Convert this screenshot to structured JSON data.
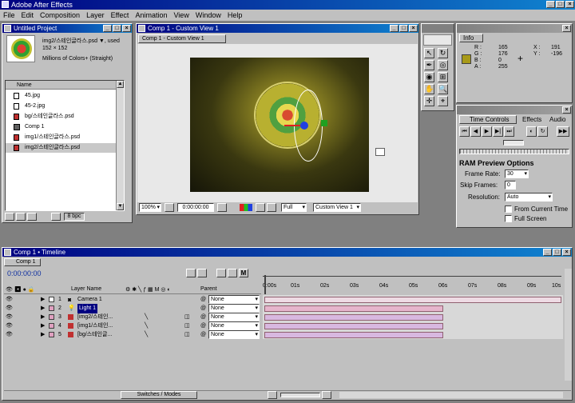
{
  "app": {
    "title": "Adobe After Effects",
    "window_buttons": [
      "_",
      "□",
      "×"
    ]
  },
  "menu": [
    "File",
    "Edit",
    "Composition",
    "Layer",
    "Effect",
    "Animation",
    "View",
    "Window",
    "Help"
  ],
  "project": {
    "title": "Untitled Project",
    "preview_name": "img2/스테인글라스.psd ▼, used",
    "preview_size": "152 × 152",
    "preview_colors": "Millions of Colors+ (Straight)",
    "col_name": "Name",
    "items": [
      {
        "icon": "file",
        "label": "45.jpg"
      },
      {
        "icon": "file",
        "label": "45-2.jpg"
      },
      {
        "icon": "psd",
        "label": "bg/스테인글라스.psd"
      },
      {
        "icon": "comp",
        "label": "Comp 1"
      },
      {
        "icon": "psd",
        "label": "img1/스테인글라스.psd"
      },
      {
        "icon": "psd",
        "label": "img2/스테인글라스.psd"
      }
    ],
    "bpc": "8 bpc"
  },
  "comp": {
    "title": "Comp 1 - Custom View 1",
    "tab": "Comp 1 - Custom View 1",
    "zoom": "100%",
    "timecode": "0:00:00:00",
    "resolution": "Full",
    "view": "Custom View 1"
  },
  "tools": [
    "arrow",
    "rotate",
    "pen",
    "orbit",
    "camera",
    "track-xy",
    "hand",
    "zoom",
    "axis",
    "pan"
  ],
  "info": {
    "title": "Info",
    "r_label": "R :",
    "r_val": "165",
    "g_label": "G :",
    "g_val": "176",
    "b_label": "B :",
    "b_val": "0",
    "a_label": "A :",
    "a_val": "255",
    "x_label": "X :",
    "x_val": "191",
    "y_label": "Y :",
    "y_val": "-196",
    "swatch": "#a89a18"
  },
  "timecontrols": {
    "tab1": "Time Controls",
    "tab2": "Effects",
    "tab3": "Audio",
    "ram_title": "RAM Preview Options",
    "frame_rate_label": "Frame Rate:",
    "frame_rate": "30",
    "skip_label": "Skip Frames:",
    "skip": "0",
    "res_label": "Resolution:",
    "res": "Auto",
    "from_current": "From Current Time",
    "full_screen": "Full Screen"
  },
  "timeline": {
    "title": "Comp 1 • Timeline",
    "tab": "Comp 1",
    "timecode": "0:00:00:00",
    "col_layer": "Layer Name",
    "col_parent": "Parent",
    "ruler": [
      "0:00s",
      "01s",
      "02s",
      "03s",
      "04s",
      "05s",
      "06s",
      "07s",
      "08s",
      "09s",
      "10s"
    ],
    "switches": "Switches / Modes",
    "layers": [
      {
        "num": "1",
        "name": "Camera 1",
        "parent": "None",
        "color": "#ffffff",
        "bar_end": 1.0
      },
      {
        "num": "2",
        "name": "Light 1",
        "parent": "None",
        "color": "#e0d040",
        "bar_end": 0.6
      },
      {
        "num": "3",
        "name": "[img2/스테인...",
        "parent": "None",
        "color": "#e0a0c0",
        "bar_end": 0.6
      },
      {
        "num": "4",
        "name": "[img1/스테인...",
        "parent": "None",
        "color": "#e0a0c0",
        "bar_end": 0.6
      },
      {
        "num": "5",
        "name": "[bg/스테인글...",
        "parent": "None",
        "color": "#e0a0c0",
        "bar_end": 0.6
      }
    ]
  }
}
